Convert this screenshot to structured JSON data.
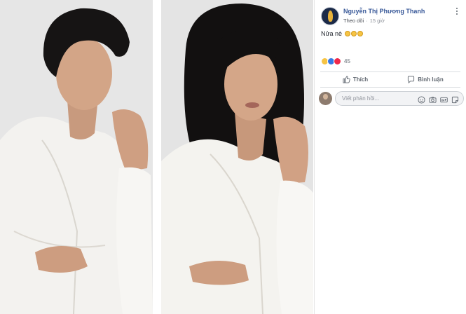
{
  "post": {
    "author": "Nguyễn Thị Phương Thanh",
    "follow": "Theo dõi",
    "separator": "·",
    "time": "15 giờ",
    "text": "Nửa nè",
    "reaction_count": "45"
  },
  "actions": {
    "like": "Thích",
    "comment": "Bình luận"
  },
  "comment_box": {
    "placeholder": "Viết phản hồi..."
  },
  "icons": [
    "more-icon",
    "thumbs-up-icon",
    "comment-icon",
    "emoji-icon",
    "camera-icon",
    "gif-icon",
    "sticker-icon"
  ],
  "colors": {
    "name_link": "#385898",
    "like": "#3578e5",
    "love": "#f0284a"
  }
}
